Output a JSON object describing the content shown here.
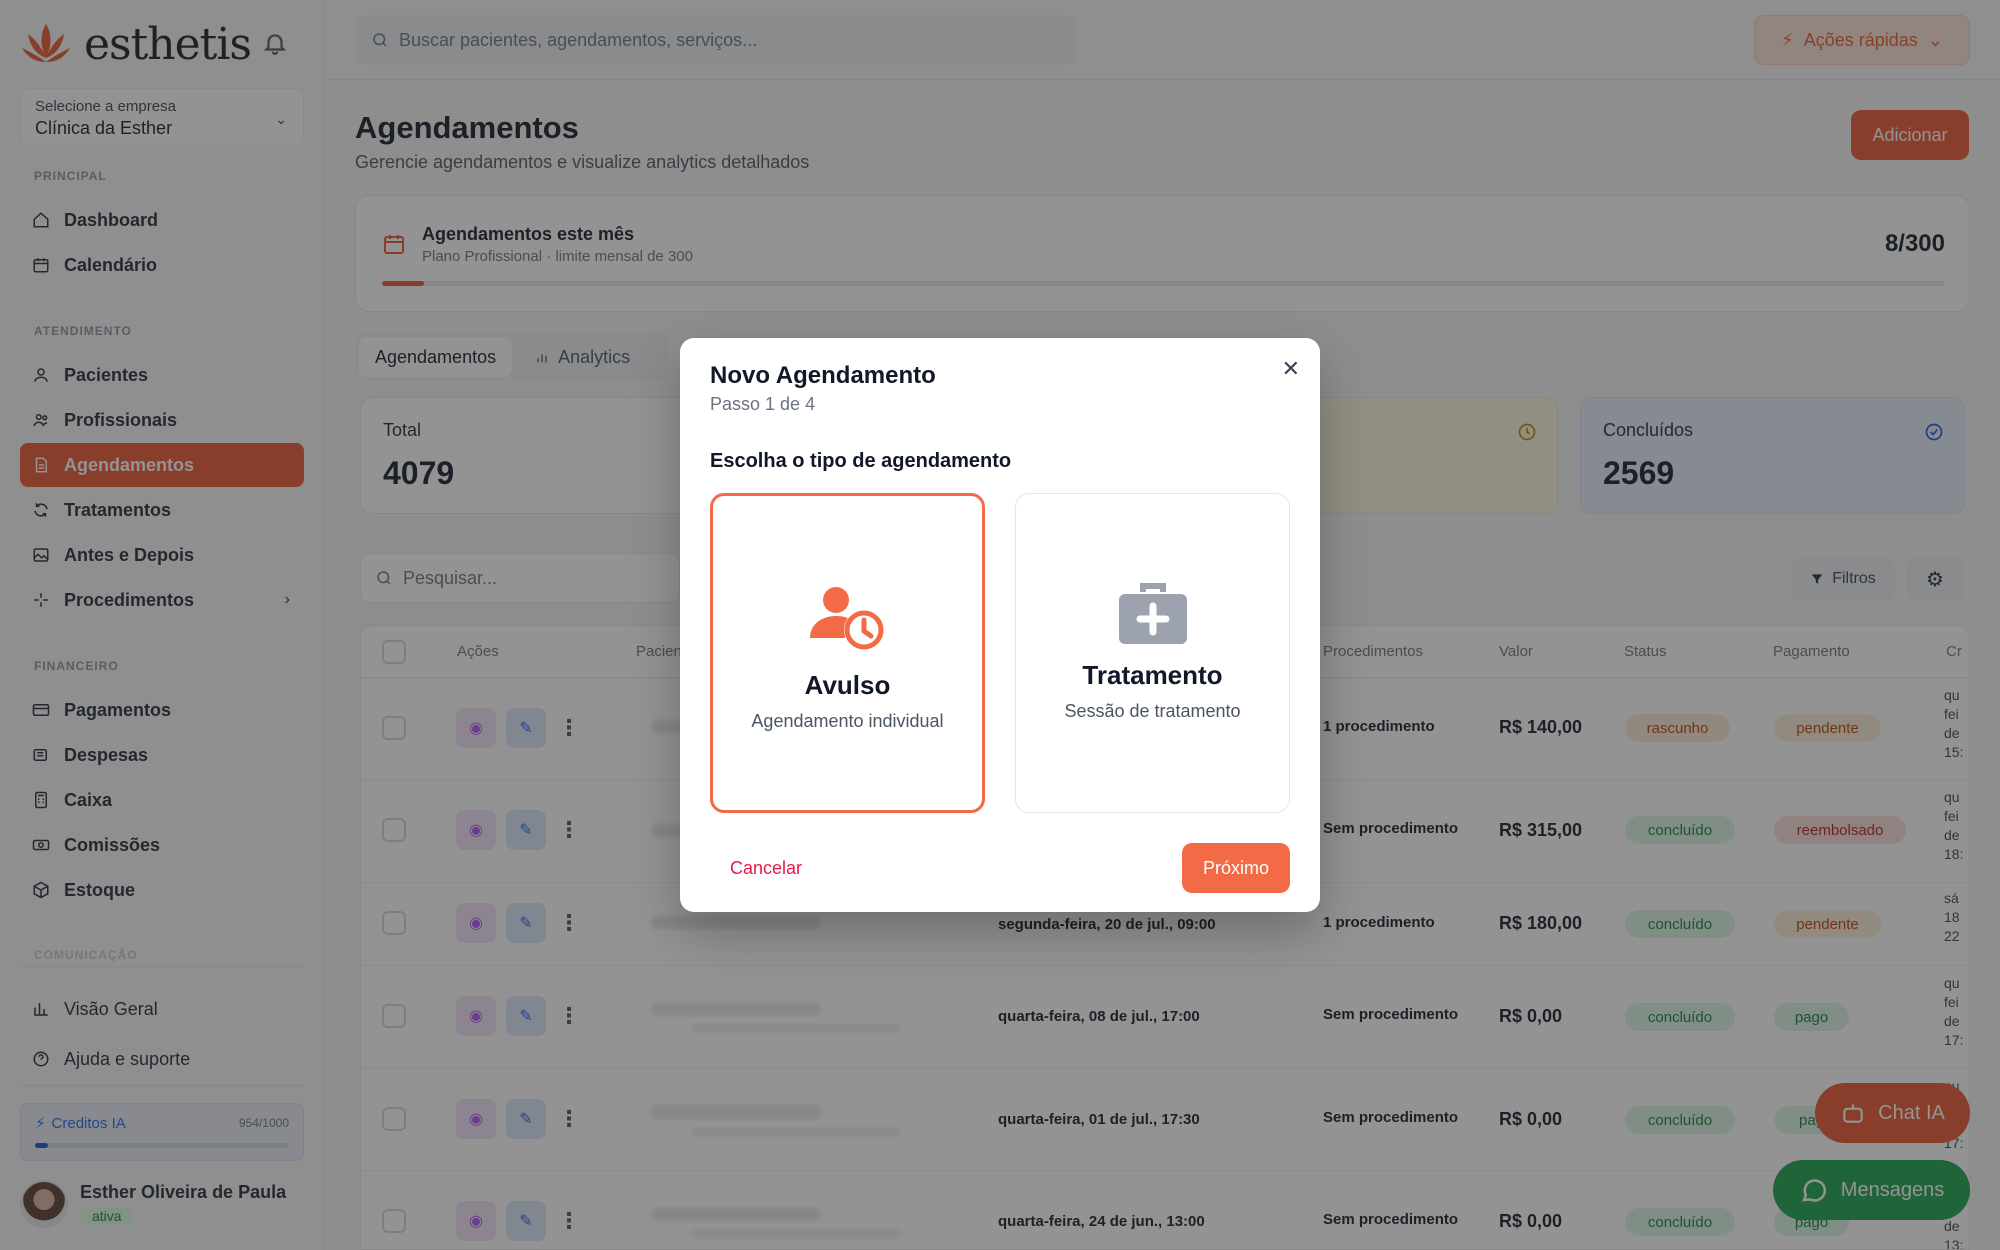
{
  "app": {
    "brand": "esthetis",
    "company_label": "Selecione a empresa",
    "company_value": "Clínica da Esther"
  },
  "colors": {
    "accent": "#e8552f",
    "primary_modal": "#f26b46",
    "success": "#16a34a",
    "info": "#2563eb"
  },
  "sidebar": {
    "sections": {
      "principal": "PRINCIPAL",
      "atendimento": "ATENDIMENTO",
      "financeiro": "FINANCEIRO",
      "comunicacao": "COMUNICAÇÃO"
    },
    "items": [
      {
        "label": "Dashboard",
        "icon": "home-icon"
      },
      {
        "label": "Calendário",
        "icon": "calendar-icon"
      },
      {
        "label": "Pacientes",
        "icon": "user-icon"
      },
      {
        "label": "Profissionais",
        "icon": "users-icon"
      },
      {
        "label": "Agendamentos",
        "icon": "document-icon",
        "active": true
      },
      {
        "label": "Tratamentos",
        "icon": "refresh-icon"
      },
      {
        "label": "Antes e Depois",
        "icon": "image-icon"
      },
      {
        "label": "Procedimentos",
        "icon": "sparkle-icon"
      },
      {
        "label": "Pagamentos",
        "icon": "card-icon"
      },
      {
        "label": "Despesas",
        "icon": "receipt-icon"
      },
      {
        "label": "Caixa",
        "icon": "calculator-icon"
      },
      {
        "label": "Comissões",
        "icon": "money-icon"
      },
      {
        "label": "Estoque",
        "icon": "box-icon"
      },
      {
        "label": "Visão Geral",
        "icon": "chart-icon"
      },
      {
        "label": "Ajuda e suporte",
        "icon": "help-icon"
      }
    ],
    "credits": {
      "label": "Creditos IA",
      "count": "954/1000",
      "fraction": 0.05
    },
    "user": {
      "name": "Esther Oliveira de Paula",
      "status": "ativa"
    }
  },
  "topbar": {
    "search_placeholder": "Buscar pacientes, agendamentos, serviços...",
    "quick_actions": "Ações rápidas"
  },
  "page": {
    "title": "Agendamentos",
    "subtitle": "Gerencie agendamentos e visualize analytics detalhados",
    "add_button": "Adicionar"
  },
  "usage": {
    "title": "Agendamentos este mês",
    "subtitle": "Plano Profissional · limite mensal de 300",
    "count": "8/300",
    "fraction": 0.027
  },
  "tabs": [
    "Agendamentos",
    "Analytics"
  ],
  "cards": {
    "total_label": "Total",
    "total_value": "4079",
    "done_label": "Concluídos",
    "done_value": "2569"
  },
  "table": {
    "search_placeholder": "Pesquisar...",
    "filters_label": "Filtros",
    "headers": {
      "actions": "Ações",
      "patient": "Pacien",
      "procedures": "Procedimentos",
      "value": "Valor",
      "status": "Status",
      "payment": "Pagamento",
      "created": "Cr"
    },
    "rows": [
      {
        "date": "",
        "procedures": "1 procedimento",
        "value": "R$ 140,00",
        "status": "rascunho",
        "payment": "pendente",
        "created": "qu fei de 15:"
      },
      {
        "date": "",
        "procedures": "Sem procedimento",
        "value": "R$ 315,00",
        "status": "concluído",
        "payment": "reembolsado",
        "created": "qu fei de 18:"
      },
      {
        "date": "segunda-feira, 20 de jul., 09:00",
        "procedures": "1 procedimento",
        "value": "R$ 180,00",
        "status": "concluído",
        "payment": "pendente",
        "created": "sá 18 22"
      },
      {
        "date": "quarta-feira, 08 de jul., 17:00",
        "procedures": "Sem procedimento",
        "value": "R$ 0,00",
        "status": "concluído",
        "payment": "pago",
        "created": "qu fei de 17:"
      },
      {
        "date": "quarta-feira, 01 de jul., 17:30",
        "procedures": "Sem procedimento",
        "value": "R$ 0,00",
        "status": "concluído",
        "payment": "pag",
        "created": "qu fei de 17:"
      },
      {
        "date": "quarta-feira, 24 de jun., 13:00",
        "procedures": "Sem procedimento",
        "value": "R$ 0,00",
        "status": "concluído",
        "payment": "pago",
        "created": "qu fei de 13:"
      }
    ]
  },
  "floating": {
    "chat": "Chat IA",
    "messages": "Mensagens"
  },
  "modal": {
    "title": "Novo Agendamento",
    "step": "Passo 1 de 4",
    "question": "Escolha o tipo de agendamento",
    "options": [
      {
        "title": "Avulso",
        "subtitle": "Agendamento individual",
        "selected": true
      },
      {
        "title": "Tratamento",
        "subtitle": "Sessão de tratamento",
        "selected": false
      }
    ],
    "cancel": "Cancelar",
    "next": "Próximo"
  }
}
